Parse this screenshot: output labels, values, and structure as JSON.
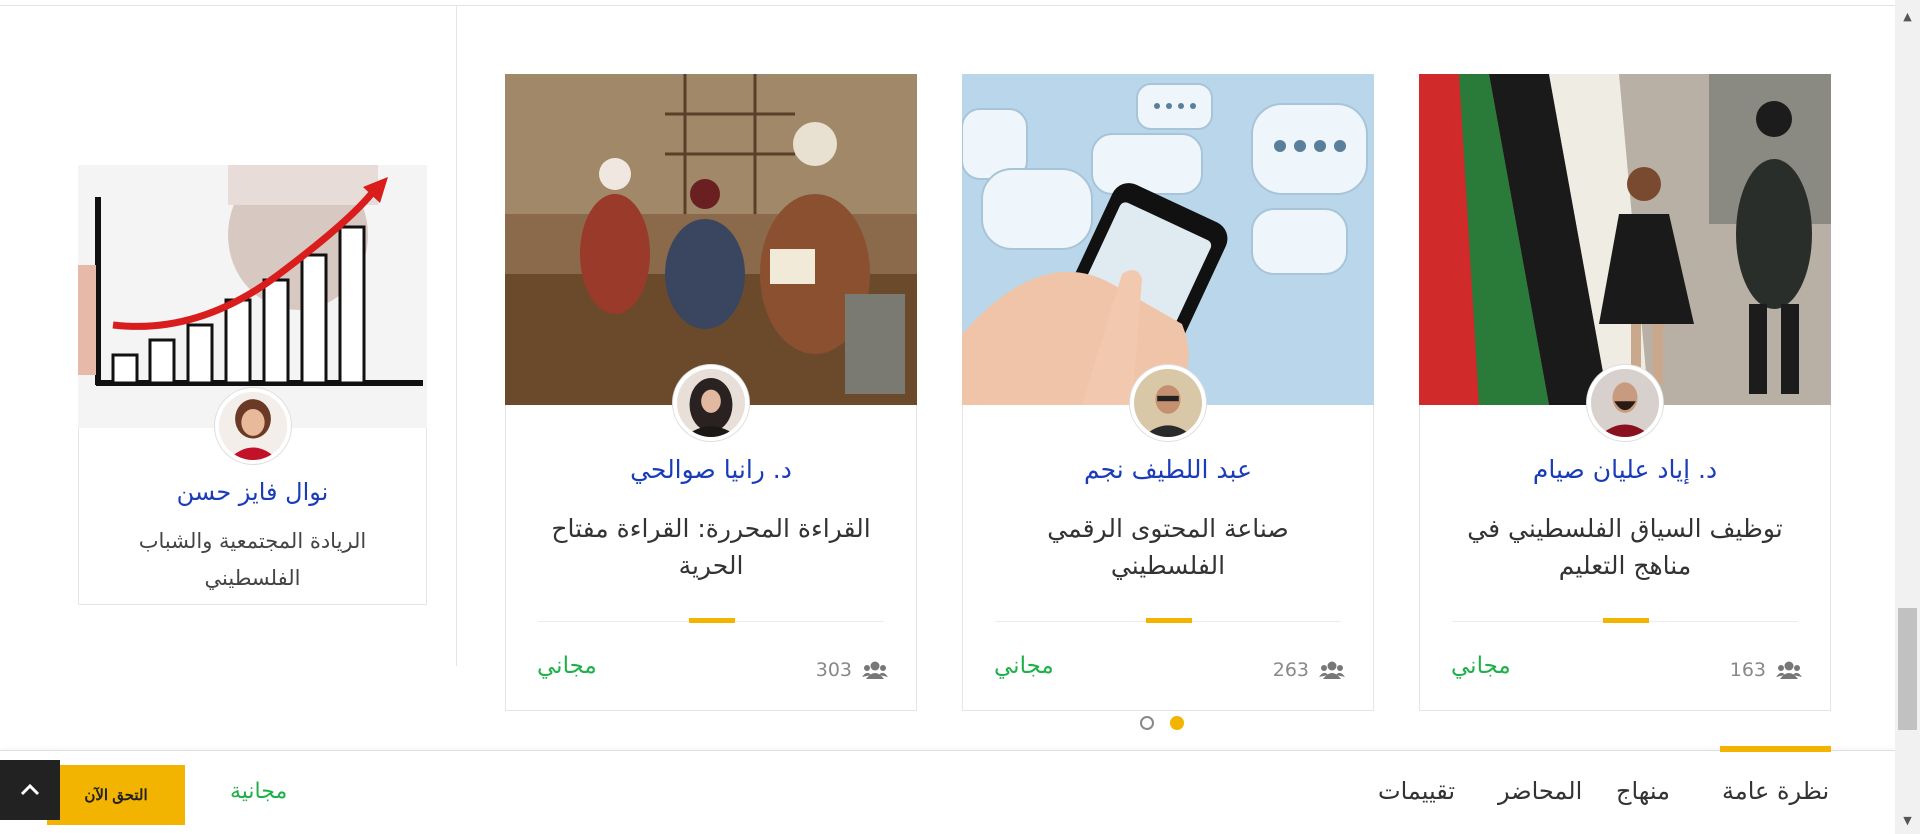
{
  "courses": [
    {
      "instructor": "د. إياد عليان صيام",
      "title": "توظيف السياق الفلسطيني في مناهج التعليم",
      "students": "163",
      "price": "مجاني"
    },
    {
      "instructor": "عبد اللطيف نجم",
      "title": "صناعة المحتوى الرقمي الفلسطيني",
      "students": "263",
      "price": "مجاني"
    },
    {
      "instructor": "د. رانيا صوالحي",
      "title": "القراءة المحررة: القراءة مفتاح الحرية",
      "students": "303",
      "price": "مجاني"
    }
  ],
  "side_course": {
    "instructor": "نوال فايز حسن",
    "title": "الريادة المجتمعية والشباب الفلسطيني"
  },
  "carousel": {
    "pages": 2,
    "active_index": 1
  },
  "tabs": [
    {
      "label": "نظرة عامة",
      "active": true
    },
    {
      "label": "منهاج",
      "active": false
    },
    {
      "label": "المحاضر",
      "active": false
    },
    {
      "label": "تقييمات",
      "active": false
    }
  ],
  "bottom_bar": {
    "price_label": "مجانية",
    "cta_label": "التحق الآن"
  },
  "colors": {
    "accent": "#f2b400",
    "instructor_link": "#1a3cb8",
    "free_green": "#1fb04a"
  },
  "icons": {
    "students": "users-icon",
    "back_to_top": "chevron-up-icon"
  }
}
